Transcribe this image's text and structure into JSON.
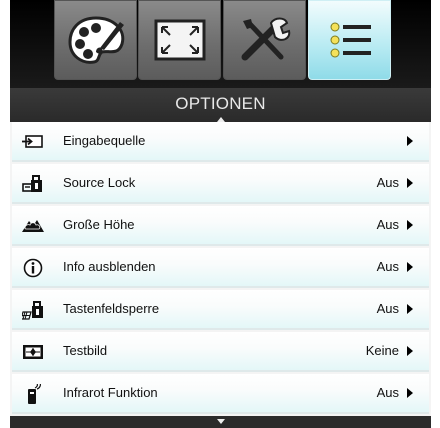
{
  "tabs": [
    {
      "name": "palette-icon",
      "active": false
    },
    {
      "name": "screen-resize-icon",
      "active": false
    },
    {
      "name": "tools-icon",
      "active": false
    },
    {
      "name": "menu-list-icon",
      "active": true
    }
  ],
  "header": {
    "title": "OPTIONEN"
  },
  "items": [
    {
      "label": "Eingabequelle",
      "value": "",
      "icon": "input-source-icon"
    },
    {
      "label": "Source Lock",
      "value": "Aus",
      "icon": "source-lock-icon"
    },
    {
      "label": "Große Höhe",
      "value": "Aus",
      "icon": "high-altitude-icon"
    },
    {
      "label": "Info ausblenden",
      "value": "Aus",
      "icon": "info-icon"
    },
    {
      "label": "Tastenfeldsperre",
      "value": "Aus",
      "icon": "keypad-lock-icon"
    },
    {
      "label": "Testbild",
      "value": "Keine",
      "icon": "test-pattern-icon"
    },
    {
      "label": "Infrarot Funktion",
      "value": "Aus",
      "icon": "infrared-remote-icon"
    }
  ],
  "colors": {
    "active_tab": "#b6eaf2",
    "row_tint": "#e4f7f8",
    "title_bar": "#333333"
  }
}
